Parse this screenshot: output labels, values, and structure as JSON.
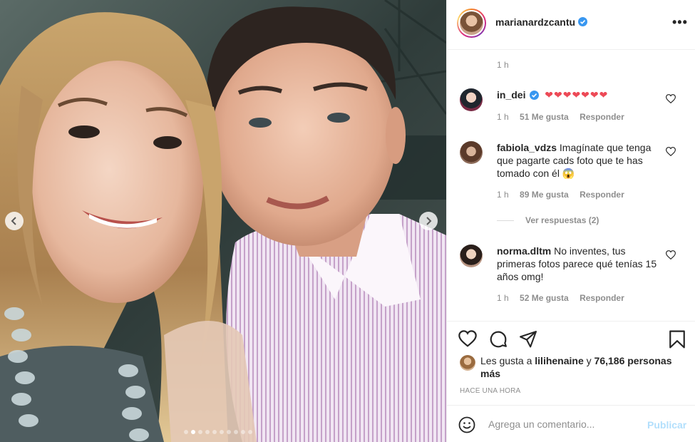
{
  "post": {
    "username": "marianardzcantu",
    "caption_time": "1 h",
    "more_label": "•••",
    "colors": {
      "accent": "#0095f6",
      "verified": "#3897f0",
      "heart_red": "#ed4956",
      "muted": "#8e8e8e"
    },
    "carousel": {
      "slide_count": 10,
      "active_index": 1
    },
    "comments": [
      {
        "user": "in_dei",
        "verified": true,
        "text": "❤❤❤❤❤❤❤",
        "time": "1 h",
        "likes": "51 Me gusta",
        "reply": "Responder"
      },
      {
        "user": "fabiola_vdzs",
        "verified": false,
        "text": "Imagínate que tenga que pagarte cads foto que te has tomado con él 😱",
        "time": "1 h",
        "likes": "89 Me gusta",
        "reply": "Responder",
        "view_replies": "Ver respuestas (2)"
      },
      {
        "user": "norma.dltm",
        "verified": false,
        "text": "No inventes, tus primeras fotos parece qué tenías 15 años omg!",
        "time": "1 h",
        "likes": "52 Me gusta",
        "reply": "Responder"
      }
    ],
    "likes": {
      "prefix": "Les gusta a",
      "user": "lilihenaine",
      "conj": "y",
      "others": "76,186 personas más"
    },
    "posted": "Hace una hora",
    "composer": {
      "placeholder": "Agrega un comentario...",
      "publish": "Publicar"
    },
    "icons": [
      "heart-icon",
      "comment-icon",
      "share-icon",
      "bookmark-icon",
      "emoji-icon",
      "verified-icon",
      "chevron-left-icon",
      "chevron-right-icon"
    ]
  }
}
